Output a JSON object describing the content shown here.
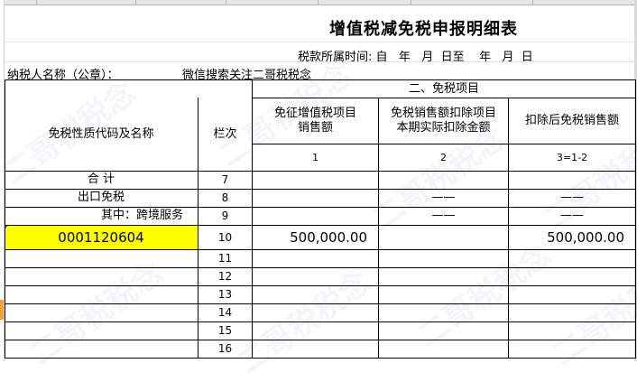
{
  "title": "增值税减免税申报明细表",
  "period_line": "税款所属时间: 自   年   月  日至    年   月  日",
  "taxpayer_label": "纳税人名称（公章）：",
  "taxpayer_value": "微信搜索关注二哥税税念",
  "section_title": "二、免税项目",
  "headers": {
    "code_name": "免税性质代码及名称",
    "line_no": "栏次",
    "col1": "免征增值税项目\n销售额",
    "col2": "免税销售额扣除项目\n本期实际扣除金额",
    "col3": "扣除后免税销售额",
    "col1_idx": "1",
    "col2_idx": "2",
    "col3_idx": "3=1-2"
  },
  "rows": [
    {
      "name": "合  计",
      "line": "7",
      "c1": "",
      "c2": "",
      "c3": ""
    },
    {
      "name": "出口免税",
      "line": "8",
      "c1": "",
      "c2": "——",
      "c3": "——"
    },
    {
      "name": "其中：跨境服务",
      "line": "9",
      "c1": "",
      "c2": "——",
      "c3": "——"
    },
    {
      "name": "0001120604",
      "line": "10",
      "c1": "500,000.00",
      "c2": "",
      "c3": "500,000.00"
    },
    {
      "name": "",
      "line": "11",
      "c1": "",
      "c2": "",
      "c3": ""
    },
    {
      "name": "",
      "line": "12",
      "c1": "",
      "c2": "",
      "c3": ""
    },
    {
      "name": "",
      "line": "13",
      "c1": "",
      "c2": "",
      "c3": ""
    },
    {
      "name": "",
      "line": "14",
      "c1": "",
      "c2": "",
      "c3": ""
    },
    {
      "name": "",
      "line": "15",
      "c1": "",
      "c2": "",
      "c3": ""
    },
    {
      "name": "",
      "line": "16",
      "c1": "",
      "c2": "",
      "c3": ""
    }
  ],
  "watermark_text": "二哥税税念",
  "colors": {
    "highlight": "#ffff00",
    "selection_marker": "#f0a040",
    "grid": "#e2e2e2"
  }
}
